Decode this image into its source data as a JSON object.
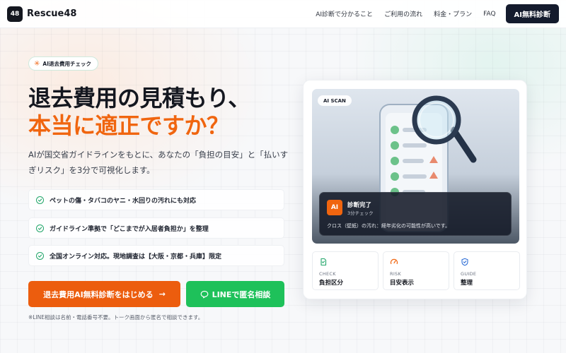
{
  "brand": {
    "logo_badge": "48",
    "name": "Rescue48"
  },
  "nav": {
    "links": [
      "AI診断で分かること",
      "ご利用の流れ",
      "料金・プラン",
      "FAQ"
    ],
    "cta": "AI無料診断"
  },
  "hero": {
    "badge": "AI退去費用チェック",
    "headline_line1": "退去費用の見積もり、",
    "headline_line2": "本当に適正ですか？",
    "lead": "AIが国交省ガイドラインをもとに、あなたの「負担の目安」と「払いすぎリスク」を3分で可視化します。",
    "features": [
      "ペットの傷・タバコのヤニ・水回りの汚れにも対応",
      "ガイドライン準拠で「どこまでが入居者負担か」を整理",
      "全国オンライン対応。現地調査は【大阪・京都・兵庫】限定"
    ],
    "primary_button": "退去費用AI無料診断をはじめる",
    "primary_arrow": "→",
    "line_button": "LINEで匿名相談",
    "note": "※LINE相談は名前・電話番号不要。トーク画面から匿名で相談できます。"
  },
  "scan_card": {
    "chip": "AI SCAN",
    "result_icon": "AI",
    "result_title": "診断完了",
    "result_sub": "3分チェック",
    "result_message": "クロス（壁紙）の汚れ：経年劣化の可能性が高いです。",
    "stats": [
      {
        "icon": "document-icon",
        "caption": "CHECK",
        "value": "負担区分"
      },
      {
        "icon": "gauge-icon",
        "caption": "RISK",
        "value": "目安表示"
      },
      {
        "icon": "shield-check-icon",
        "caption": "GUIDE",
        "value": "整理"
      }
    ]
  },
  "colors": {
    "accent_orange": "#f0650f",
    "line_green": "#1ec15a",
    "dark_navy": "#141b2d",
    "check_green": "#22a66a"
  }
}
